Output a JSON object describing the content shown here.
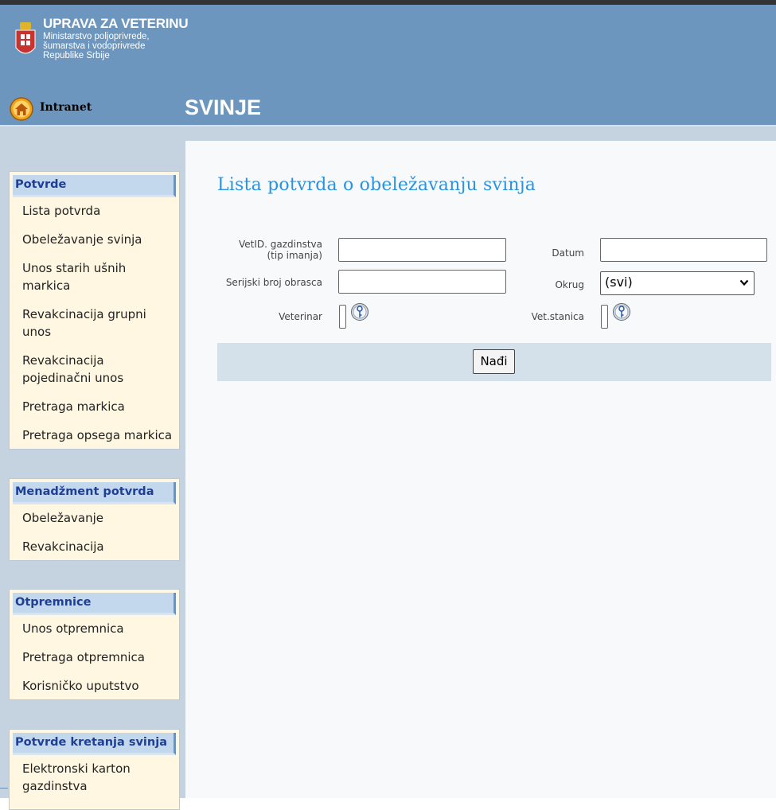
{
  "header": {
    "org_name": "UPRAVA ZA VETERINU",
    "org_sub": [
      "Ministarstvo poljoprivrede,",
      "šumarstva i vodoprivrede",
      "Republike Srbije"
    ],
    "intranet_label": "Intranet",
    "section_title": "SVINJE",
    "colors": {
      "header_bg": "#6d96be",
      "accent": "#2a93e0"
    }
  },
  "sidebar": {
    "groups": [
      {
        "title": "Potvrde",
        "items": [
          "Lista potvrda",
          "Obeležavanje svinja",
          "Unos starih ušnih markica",
          "Revakcinacija grupni unos",
          "Revakcinacija pojedinačni unos",
          "Pretraga markica",
          "Pretraga opsega markica"
        ]
      },
      {
        "title": "Menadžment potvrda",
        "items": [
          "Obeležavanje",
          "Revakcinacija"
        ]
      },
      {
        "title": "Otpremnice",
        "items": [
          "Unos otpremnica",
          "Pretraga otpremnica",
          "Korisničko uputstvo"
        ]
      },
      {
        "title": "Potvrde kretanja svinja",
        "items": [
          "Elektronski karton gazdinstva"
        ]
      }
    ]
  },
  "main": {
    "heading": "Lista potvrda o obeležavanju svinja",
    "form": {
      "vetid_label_line1": "VetID. gazdinstva",
      "vetid_label_line2": "(tip imanja)",
      "vetid_value": "",
      "datum_label": "Datum",
      "datum_value": "",
      "serijski_label": "Serijski broj obrasca",
      "serijski_value": "",
      "okrug_label": "Okrug",
      "okrug_selected": "(svi)",
      "veterinar_label": "Veterinar",
      "vetstanica_label": "Vet.stanica"
    },
    "find_button": "Nađi"
  },
  "icons": [
    "coat-of-arms-icon",
    "home-icon",
    "chevron-down-icon",
    "lookup-key-icon"
  ]
}
